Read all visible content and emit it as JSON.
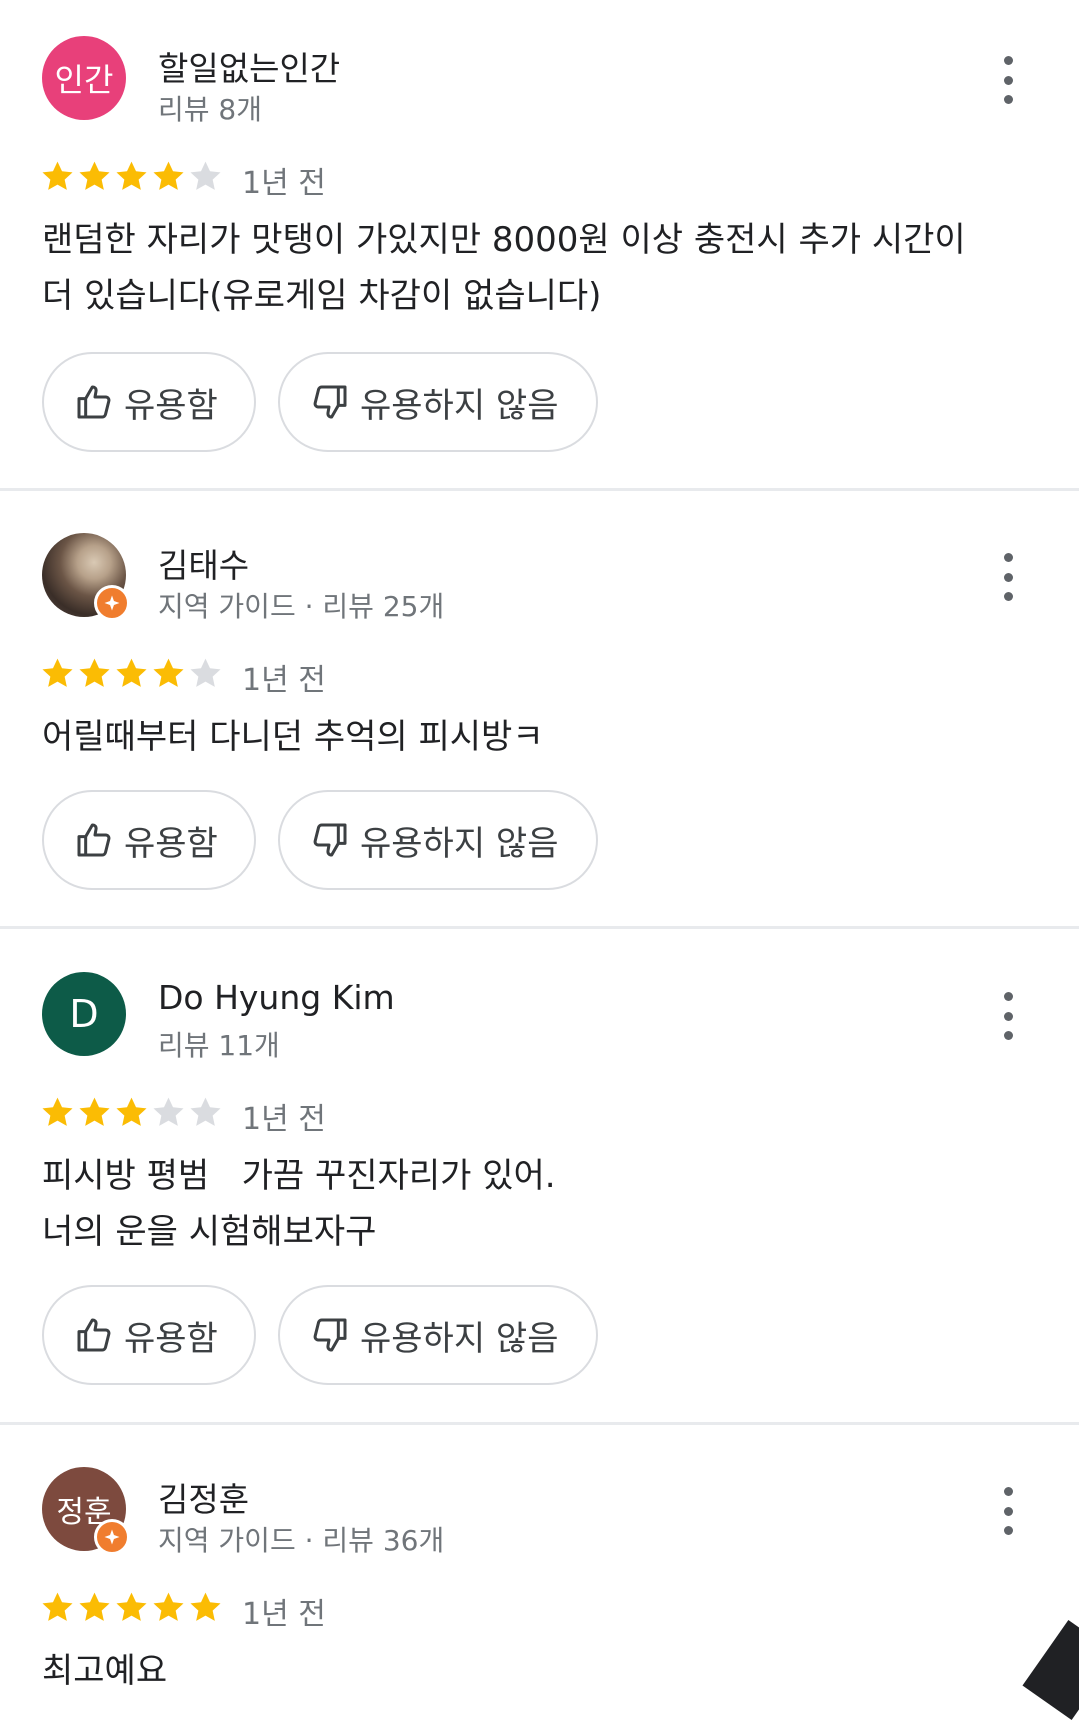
{
  "reviews": [
    {
      "avatar_text": "인간",
      "name": "할일없는인간",
      "meta": "리뷰 8개",
      "rating": 4,
      "date": "1년 전",
      "text": "랜덤한 자리가 맛탱이 가있지만 8000원 이상 충전시 추가 시간이\n더 있습니다(유로게임 차감이 없습니다)",
      "helpful_label": "유용함",
      "not_helpful_label": "유용하지 않음"
    },
    {
      "avatar_text": "",
      "name": "김태수",
      "meta": "지역 가이드 · 리뷰 25개",
      "rating": 4,
      "date": "1년 전",
      "text": "어릴때부터 다니던 추억의 피시방ㅋ",
      "helpful_label": "유용함",
      "not_helpful_label": "유용하지 않음"
    },
    {
      "avatar_text": "D",
      "name": "Do Hyung Kim",
      "meta": "리뷰 11개",
      "rating": 3,
      "date": "1년 전",
      "text": "피시방 평범   가끔 꾸진자리가 있어.\n너의 운을 시험해보자구",
      "helpful_label": "유용함",
      "not_helpful_label": "유용하지 않음"
    },
    {
      "avatar_text": "정훈",
      "name": "김정훈",
      "meta": "지역 가이드 · 리뷰 36개",
      "rating": 5,
      "date": "1년 전",
      "text": "최고예요"
    }
  ],
  "colors": {
    "star_filled": "#fbbc04",
    "star_empty": "#dadce0",
    "avatar_pink": "#e8407a",
    "avatar_green": "#0d5b48",
    "avatar_brown": "#7d4a3e",
    "local_guide_badge": "#f07d2e"
  }
}
